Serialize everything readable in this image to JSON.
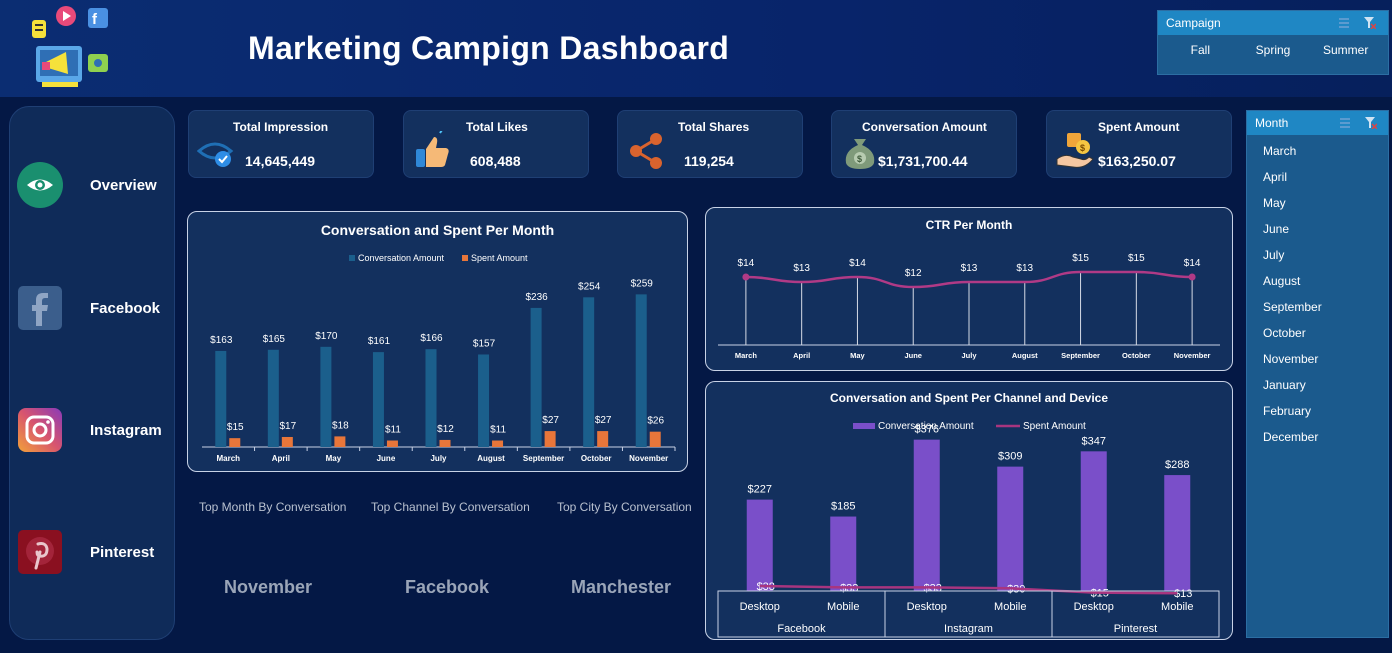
{
  "header": {
    "title": "Marketing Campign Dashboard"
  },
  "campaign_slicer": {
    "title": "Campaign",
    "items": [
      "Fall",
      "Spring",
      "Summer"
    ]
  },
  "month_slicer": {
    "title": "Month",
    "items": [
      "March",
      "April",
      "May",
      "June",
      "July",
      "August",
      "September",
      "October",
      "November",
      "January",
      "February",
      "December"
    ]
  },
  "sidebar": {
    "items": [
      {
        "label": "Overview",
        "icon": "eye-icon",
        "color": "#1a8f6f"
      },
      {
        "label": "Facebook",
        "icon": "facebook-icon",
        "color": "#3b5e8c"
      },
      {
        "label": "Instagram",
        "icon": "instagram-icon",
        "color": "#d8556e"
      },
      {
        "label": "Pinterest",
        "icon": "pinterest-icon",
        "color": "#8a1020"
      }
    ]
  },
  "kpis": [
    {
      "title": "Total  Impression",
      "value": "14,645,449",
      "icon": "eye-check-icon"
    },
    {
      "title": "Total Likes",
      "value": "608,488",
      "icon": "thumbs-up-icon"
    },
    {
      "title": "Total Shares",
      "value": "119,254",
      "icon": "share-icon"
    },
    {
      "title": "Conversation Amount",
      "value": "$1,731,700.44",
      "icon": "money-bag-icon"
    },
    {
      "title": "Spent Amount",
      "value": "$163,250.07",
      "icon": "hand-dollar-icon"
    }
  ],
  "tops": {
    "month_label": "Top Month By Conversation",
    "channel_label": "Top Channel  By Conversation",
    "city_label": "Top City  By Conversation",
    "month_value": "November",
    "channel_value": "Facebook",
    "city_value": "Manchester"
  },
  "colors": {
    "conversation": "#1b5f8c",
    "spent": "#e8763a",
    "ctr": "#b03a86",
    "channel_bar": "#7a4fc9",
    "channel_line": "#a8357f"
  },
  "chart_data": [
    {
      "type": "bar",
      "title": "Conversation and Spent Per Month",
      "categories": [
        "March",
        "April",
        "May",
        "June",
        "July",
        "August",
        "September",
        "October",
        "November"
      ],
      "series": [
        {
          "name": "Conversation Amount",
          "values": [
            163,
            165,
            170,
            161,
            166,
            157,
            236,
            254,
            259
          ],
          "labels": [
            "$163",
            "$165",
            "$170",
            "$161",
            "$166",
            "$157",
            "$236",
            "$254",
            "$259"
          ]
        },
        {
          "name": "Spent Amount",
          "values": [
            15,
            17,
            18,
            11,
            12,
            11,
            27,
            27,
            26
          ],
          "labels": [
            "$15",
            "$17",
            "$18",
            "$11",
            "$12",
            "$11",
            "$27",
            "$27",
            "$26"
          ]
        }
      ],
      "ylim": [
        0,
        280
      ],
      "legend": "top"
    },
    {
      "type": "line",
      "title": "CTR Per Month",
      "categories": [
        "March",
        "April",
        "May",
        "June",
        "July",
        "August",
        "September",
        "October",
        "November"
      ],
      "series": [
        {
          "name": "",
          "values": [
            14,
            13,
            14,
            12,
            13,
            13,
            15,
            15,
            14
          ],
          "labels": [
            "$14",
            "$13",
            "$14",
            "$12",
            "$13",
            "$13",
            "$15",
            "$15",
            "$14"
          ]
        }
      ],
      "ylim": [
        0,
        16
      ],
      "grid": "vertical"
    },
    {
      "type": "bar",
      "title": "Conversation and Spent Per Channel and Device",
      "categories": [
        "Desktop",
        "Mobile",
        "Desktop",
        "Mobile",
        "Desktop",
        "Mobile"
      ],
      "groups": [
        "Facebook",
        "Instagram",
        "Pinterest"
      ],
      "series": [
        {
          "name": "Conversation Amount",
          "type": "bar",
          "values": [
            227,
            185,
            376,
            309,
            347,
            288
          ],
          "labels": [
            "$227",
            "$185",
            "$376",
            "$309",
            "$347",
            "$288"
          ]
        },
        {
          "name": "Spent Amount",
          "type": "line",
          "values": [
            38,
            33,
            33,
            30,
            15,
            13
          ],
          "labels": [
            "$38",
            "$33",
            "$33",
            "$30",
            "$15",
            "$13"
          ]
        }
      ],
      "ylim": [
        0,
        400
      ],
      "legend": "top"
    }
  ]
}
